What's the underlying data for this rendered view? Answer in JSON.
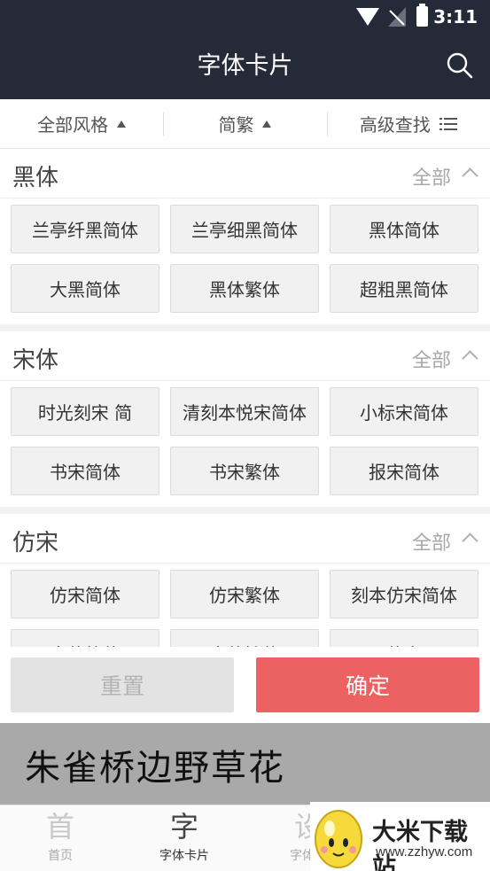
{
  "status": {
    "time": "3:11"
  },
  "header": {
    "title": "字体卡片"
  },
  "filters": [
    {
      "label": "全部风格"
    },
    {
      "label": "简繁"
    },
    {
      "label": "高级查找"
    }
  ],
  "sections": [
    {
      "title": "黑体",
      "all_label": "全部",
      "items": [
        "兰亭纤黑简体",
        "兰亭细黑简体",
        "黑体简体",
        "大黑简体",
        "黑体繁体",
        "超粗黑简体"
      ]
    },
    {
      "title": "宋体",
      "all_label": "全部",
      "items": [
        "时光刻宋 简",
        "清刻本悦宋简体",
        "小标宋简体",
        "书宋简体",
        "书宋繁体",
        "报宋简体"
      ]
    },
    {
      "title": "仿宋",
      "all_label": "全部",
      "items": [
        "仿宋简体",
        "仿宋繁体",
        "刻本仿宋简体",
        "古仿简体",
        "古仿繁体",
        "仿宋"
      ]
    }
  ],
  "actions": {
    "reset": "重置",
    "confirm": "确定"
  },
  "preview": {
    "text": "朱雀桥边野草花"
  },
  "bottom_nav": [
    {
      "glyph": "首",
      "label": "首页",
      "active": false
    },
    {
      "glyph": "字",
      "label": "字体卡片",
      "active": true
    },
    {
      "glyph": "设",
      "label": "字体设",
      "active": false
    }
  ],
  "watermark": {
    "name": "大米下载站",
    "url": "www.zzhyw.com"
  },
  "colors": {
    "header_bg": "#252a38",
    "confirm_bg": "#ec6161",
    "reset_bg": "#e3e3e3"
  }
}
